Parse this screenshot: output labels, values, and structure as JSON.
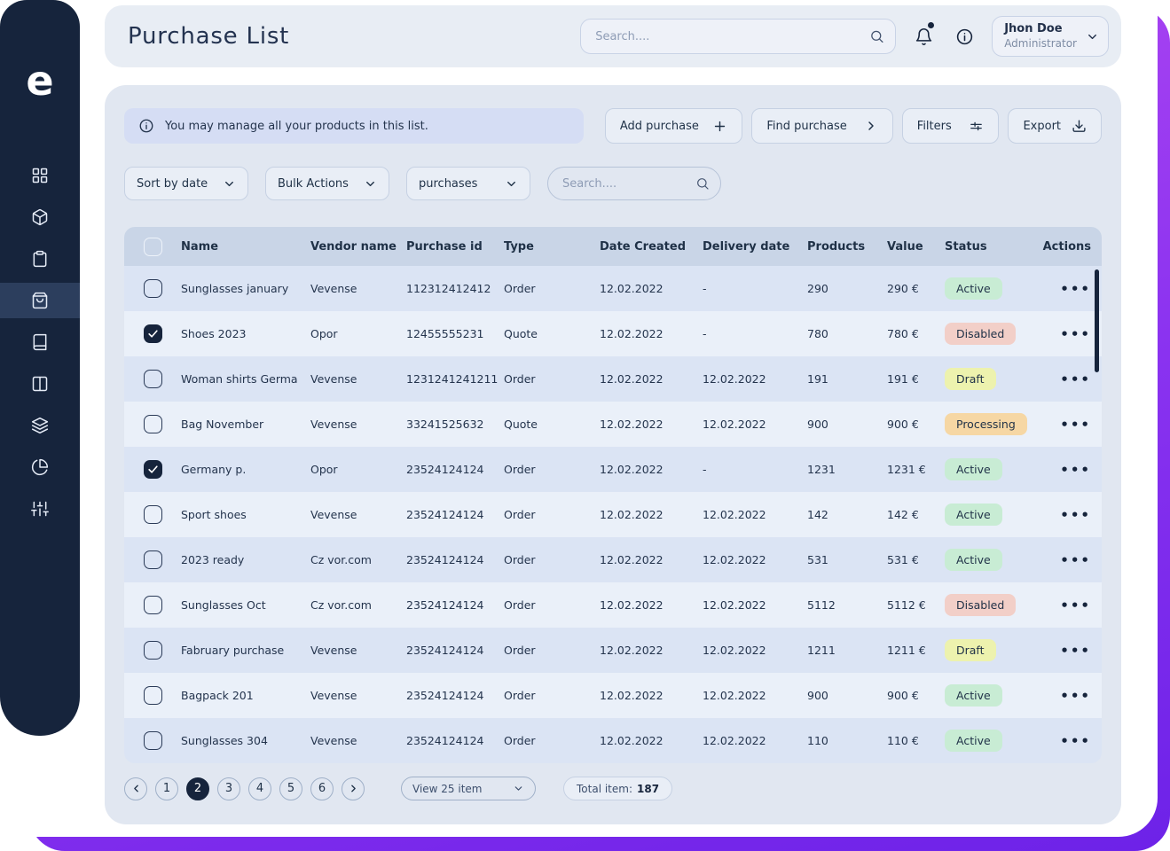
{
  "brand": {
    "logo_letter": "e"
  },
  "sidebar": {
    "items": [
      {
        "icon": "dashboard-grid-icon",
        "active": false
      },
      {
        "icon": "package-icon",
        "active": false
      },
      {
        "icon": "clipboard-icon",
        "active": false
      },
      {
        "icon": "shopping-bag-icon",
        "active": true
      },
      {
        "icon": "book-icon",
        "active": false
      },
      {
        "icon": "columns-icon",
        "active": false
      },
      {
        "icon": "layers-icon",
        "active": false
      },
      {
        "icon": "pie-chart-icon",
        "active": false
      },
      {
        "icon": "sliders-icon",
        "active": false
      }
    ]
  },
  "header": {
    "title": "Purchase List",
    "search_placeholder": "Search....",
    "user": {
      "name": "Jhon Doe",
      "role": "Administrator"
    }
  },
  "toolbar": {
    "info_text": "You may manage all your products in this list.",
    "add_purchase_label": "Add purchase",
    "find_purchase_label": "Find purchase",
    "filters_label": "Filters",
    "export_label": "Export"
  },
  "controls": {
    "sort_label": "Sort by date",
    "bulk_label": "Bulk Actions",
    "entity_label": "purchases",
    "search_placeholder": "Search...."
  },
  "table": {
    "columns": [
      "Name",
      "Vendor name",
      "Purchase id",
      "Type",
      "Date Created",
      "Delivery date",
      "Products",
      "Value",
      "Status",
      "Actions"
    ],
    "rows": [
      {
        "name": "Sunglasses january",
        "vendor": "Vevense",
        "purchase_id": "112312412412",
        "type": "Order",
        "date_created": "12.02.2022",
        "delivery_date": "-",
        "products": "290",
        "value": "290 €",
        "status": "Active",
        "checked": false
      },
      {
        "name": "Shoes 2023",
        "vendor": "Opor",
        "purchase_id": "12455555231",
        "type": "Quote",
        "date_created": "12.02.2022",
        "delivery_date": "-",
        "products": "780",
        "value": "780 €",
        "status": "Disabled",
        "checked": true
      },
      {
        "name": "Woman shirts Germa",
        "vendor": "Vevense",
        "purchase_id": "1231241241211",
        "type": "Order",
        "date_created": "12.02.2022",
        "delivery_date": "12.02.2022",
        "products": "191",
        "value": "191 €",
        "status": "Draft",
        "checked": false
      },
      {
        "name": "Bag November",
        "vendor": "Vevense",
        "purchase_id": "33241525632",
        "type": "Quote",
        "date_created": "12.02.2022",
        "delivery_date": "12.02.2022",
        "products": "900",
        "value": "900 €",
        "status": "Processing",
        "checked": false
      },
      {
        "name": "Germany p.",
        "vendor": "Opor",
        "purchase_id": "23524124124",
        "type": "Order",
        "date_created": "12.02.2022",
        "delivery_date": "-",
        "products": "1231",
        "value": "1231 €",
        "status": "Active",
        "checked": true
      },
      {
        "name": "Sport shoes",
        "vendor": "Vevense",
        "purchase_id": "23524124124",
        "type": "Order",
        "date_created": "12.02.2022",
        "delivery_date": "12.02.2022",
        "products": "142",
        "value": "142 €",
        "status": "Active",
        "checked": false
      },
      {
        "name": "2023 ready",
        "vendor": "Cz vor.com",
        "purchase_id": "23524124124",
        "type": "Order",
        "date_created": "12.02.2022",
        "delivery_date": "12.02.2022",
        "products": "531",
        "value": "531 €",
        "status": "Active",
        "checked": false
      },
      {
        "name": "Sunglasses Oct",
        "vendor": "Cz vor.com",
        "purchase_id": "23524124124",
        "type": "Order",
        "date_created": "12.02.2022",
        "delivery_date": "12.02.2022",
        "products": "5112",
        "value": "5112 €",
        "status": "Disabled",
        "checked": false
      },
      {
        "name": "Fabruary purchase",
        "vendor": "Vevense",
        "purchase_id": "23524124124",
        "type": "Order",
        "date_created": "12.02.2022",
        "delivery_date": "12.02.2022",
        "products": "1211",
        "value": "1211 €",
        "status": "Draft",
        "checked": false
      },
      {
        "name": "Bagpack 201",
        "vendor": "Vevense",
        "purchase_id": "23524124124",
        "type": "Order",
        "date_created": "12.02.2022",
        "delivery_date": "12.02.2022",
        "products": "900",
        "value": "900 €",
        "status": "Active",
        "checked": false
      },
      {
        "name": "Sunglasses 304",
        "vendor": "Vevense",
        "purchase_id": "23524124124",
        "type": "Order",
        "date_created": "12.02.2022",
        "delivery_date": "12.02.2022",
        "products": "110",
        "value": "110 €",
        "status": "Active",
        "checked": false
      }
    ]
  },
  "status_styles": {
    "Active": {
      "bg": "#c8ecd4",
      "text": "#1f3147"
    },
    "Disabled": {
      "bg": "#f2cfc8",
      "text": "#1f3147"
    },
    "Draft": {
      "bg": "#edf2ae",
      "text": "#1f3147"
    },
    "Processing": {
      "bg": "#f6d7a4",
      "text": "#1f3147"
    }
  },
  "pagination": {
    "pages": [
      "1",
      "2",
      "3",
      "4",
      "5",
      "6"
    ],
    "active_page": "2",
    "view_label": "View 25 item",
    "total_label": "Total item:",
    "total_value": "187"
  }
}
